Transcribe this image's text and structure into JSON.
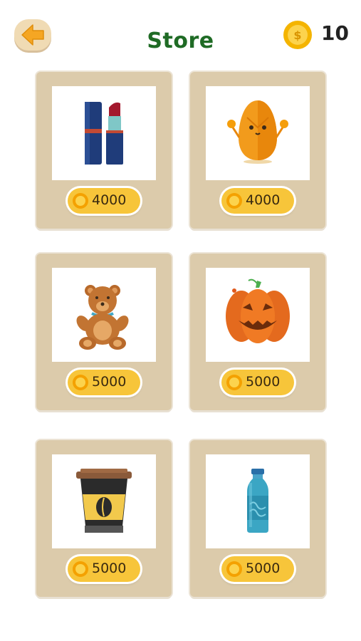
{
  "header": {
    "title": "Store",
    "coin_count": "10",
    "back_icon": "arrow-left-icon",
    "coin_icon": "gold-coin-icon"
  },
  "colors": {
    "title": "#1f6b25",
    "card_bg": "#dccbab",
    "price_pill": "#f7c53a",
    "back_button": "#f0dbb4",
    "back_arrow": "#f5a623"
  },
  "items": [
    {
      "name": "lipstick",
      "icon": "lipstick-icon",
      "price": "4000"
    },
    {
      "name": "egg-character",
      "icon": "egg-character-icon",
      "price": "4000"
    },
    {
      "name": "teddy-bear",
      "icon": "teddy-bear-icon",
      "price": "5000"
    },
    {
      "name": "pumpkin",
      "icon": "jack-o-lantern-icon",
      "price": "5000"
    },
    {
      "name": "coffee-cup",
      "icon": "coffee-cup-icon",
      "price": "5000"
    },
    {
      "name": "water-bottle",
      "icon": "water-bottle-icon",
      "price": "5000"
    }
  ]
}
